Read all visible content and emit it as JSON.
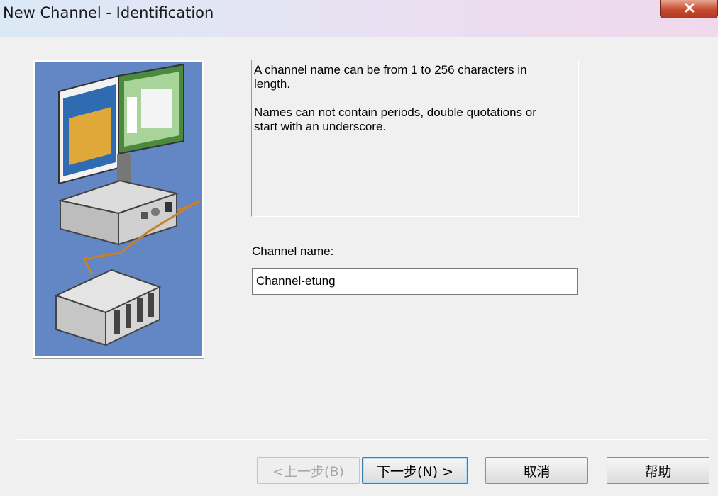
{
  "window": {
    "title": "New Channel - Identification"
  },
  "description": {
    "line1": "A channel name can be from 1 to 256 characters in length.",
    "line2": "Names can not contain periods, double quotations or start with an underscore."
  },
  "channel_name": {
    "label": "Channel name:",
    "value": "Channel-etung"
  },
  "buttons": {
    "back": "<上一步(B)",
    "next": "下一步(N) >",
    "cancel": "取消",
    "help": "帮助"
  },
  "colors": {
    "panel_blue": "#6287c4",
    "default_button_border": "#3c7fb1",
    "close_button": "#c7492e"
  }
}
